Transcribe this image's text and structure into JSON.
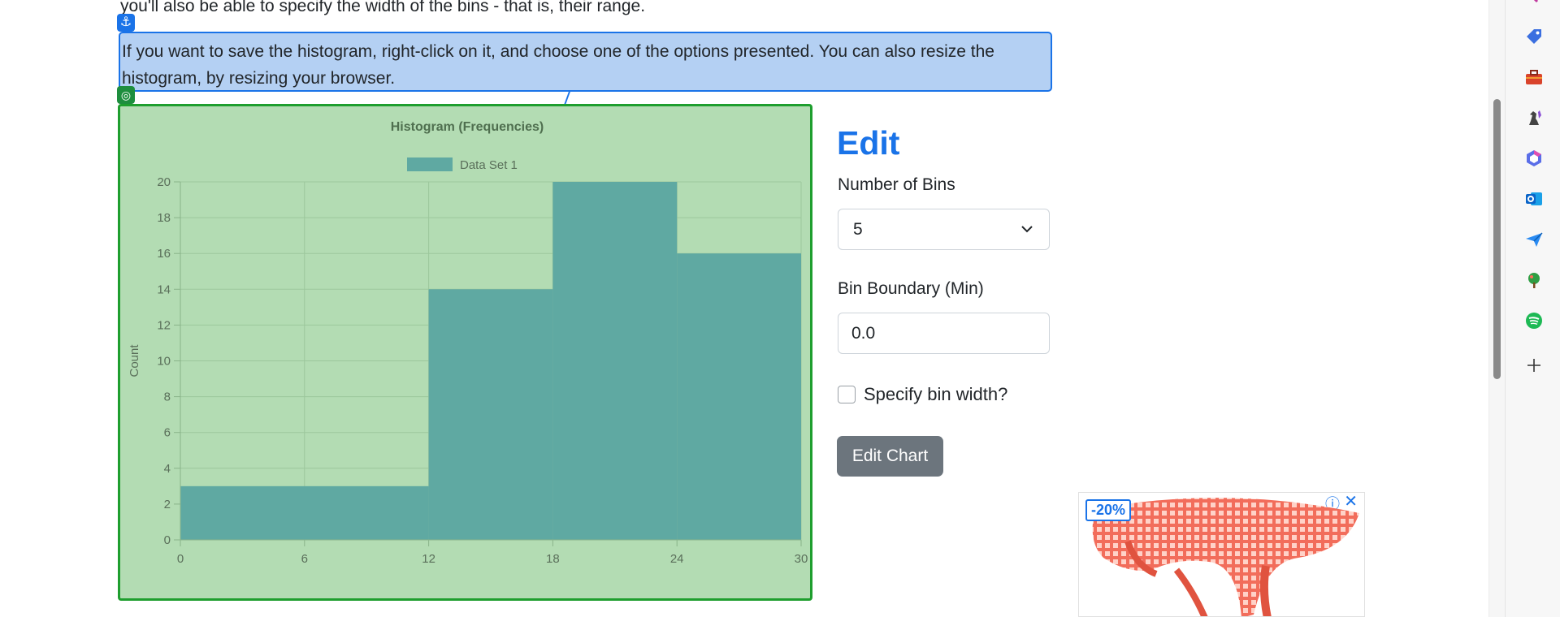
{
  "article": {
    "top_line": "you'll also be able to specify the width of the bins - that is, their range.",
    "selected_paragraph": "If you want to save the histogram, right-click on it, and choose one of the options presented. You can also resize the histogram, by resizing your browser."
  },
  "chart_data": {
    "type": "bar",
    "title": "Histogram (Frequencies)",
    "ylabel": "Count",
    "xlabel": "",
    "x_ticks": [
      0,
      6,
      12,
      18,
      24,
      30
    ],
    "y_ticks": [
      0,
      2,
      4,
      6,
      8,
      10,
      12,
      14,
      16,
      18,
      20
    ],
    "ylim": [
      0,
      20
    ],
    "xlim": [
      0,
      30
    ],
    "legend_position": "top",
    "grid": true,
    "series": [
      {
        "name": "Data Set 1",
        "color": "#5fa9a2",
        "bins": [
          {
            "x0": 0,
            "x1": 12,
            "value": 3
          },
          {
            "x0": 12,
            "x1": 18,
            "value": 14
          },
          {
            "x0": 18,
            "x1": 24,
            "value": 20
          },
          {
            "x0": 24,
            "x1": 30,
            "value": 16
          }
        ]
      }
    ]
  },
  "edit_panel": {
    "title": "Edit",
    "bins_label": "Number of Bins",
    "bins_value": "5",
    "min_label": "Bin Boundary (Min)",
    "min_value": "0.0",
    "width_checkbox_label": "Specify bin width?",
    "width_checked": false,
    "button_label": "Edit Chart"
  },
  "ad": {
    "badge": "-20%"
  },
  "sidebar": {
    "icons": [
      "tag-icon",
      "toolbox-icon",
      "chess-icon",
      "copilot-icon",
      "outlook-icon",
      "send-icon",
      "tree-icon",
      "spotify-icon",
      "add-icon"
    ]
  }
}
